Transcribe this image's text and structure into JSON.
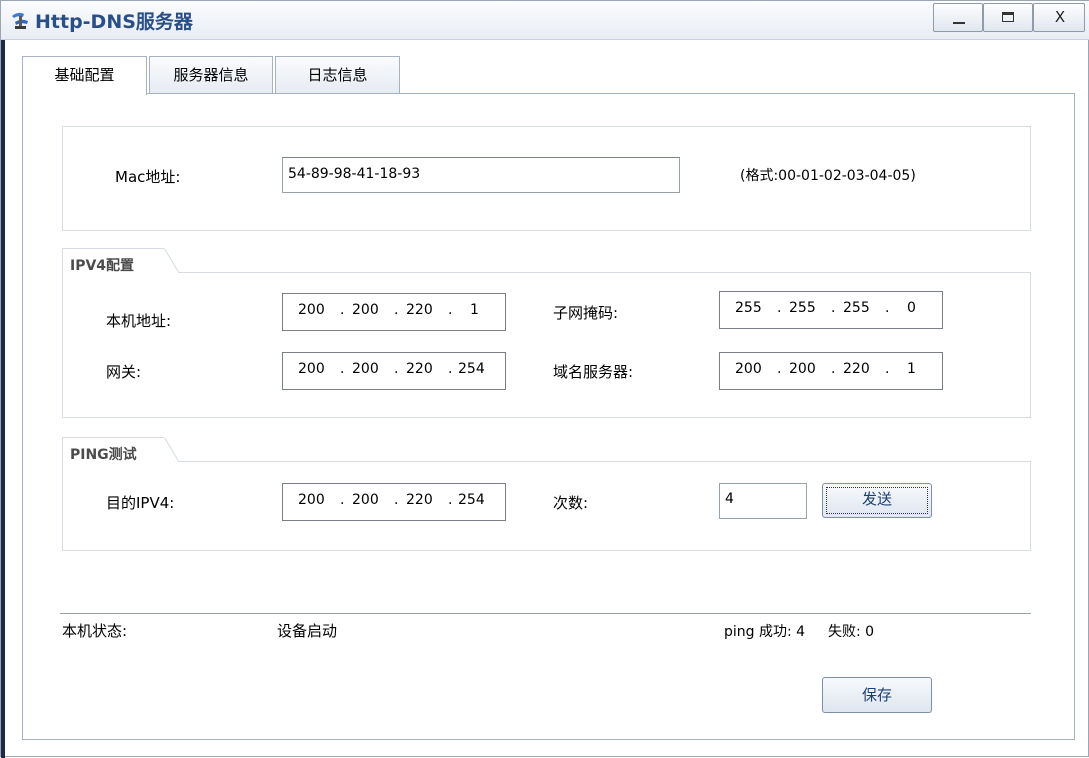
{
  "window": {
    "title": "Http-DNS服务器",
    "controls": {
      "minimize_icon": "minimize-icon",
      "maximize_icon": "maximize-icon",
      "close_label": "X"
    }
  },
  "tabs": [
    {
      "label": "基础配置",
      "active": true
    },
    {
      "label": "服务器信息",
      "active": false
    },
    {
      "label": "日志信息",
      "active": false
    }
  ],
  "mac": {
    "label": "Mac地址:",
    "value": "54-89-98-41-18-93",
    "format_hint": "(格式:00-01-02-03-04-05)"
  },
  "ipv4": {
    "group_title": "IPV4配置",
    "local_address": {
      "label": "本机地址:",
      "segments": [
        "200",
        "200",
        "220",
        "1"
      ]
    },
    "subnet_mask": {
      "label": "子网掩码:",
      "segments": [
        "255",
        "255",
        "255",
        "0"
      ]
    },
    "gateway": {
      "label": "网关:",
      "segments": [
        "200",
        "200",
        "220",
        "254"
      ]
    },
    "dns_server": {
      "label": "域名服务器:",
      "segments": [
        "200",
        "200",
        "220",
        "1"
      ]
    }
  },
  "ping": {
    "group_title": "PING测试",
    "target": {
      "label": "目的IPV4:",
      "segments": [
        "200",
        "200",
        "220",
        "254"
      ]
    },
    "count": {
      "label": "次数:",
      "value": "4"
    },
    "send_label": "发送"
  },
  "status": {
    "label": "本机状态:",
    "value": "设备启动",
    "ping_success_label": "ping 成功:",
    "ping_success_value": "4",
    "ping_fail_label": "失败:",
    "ping_fail_value": "0"
  },
  "save_label": "保存",
  "colors": {
    "title": "#2a4f86",
    "button_text": "#1b3f73"
  }
}
